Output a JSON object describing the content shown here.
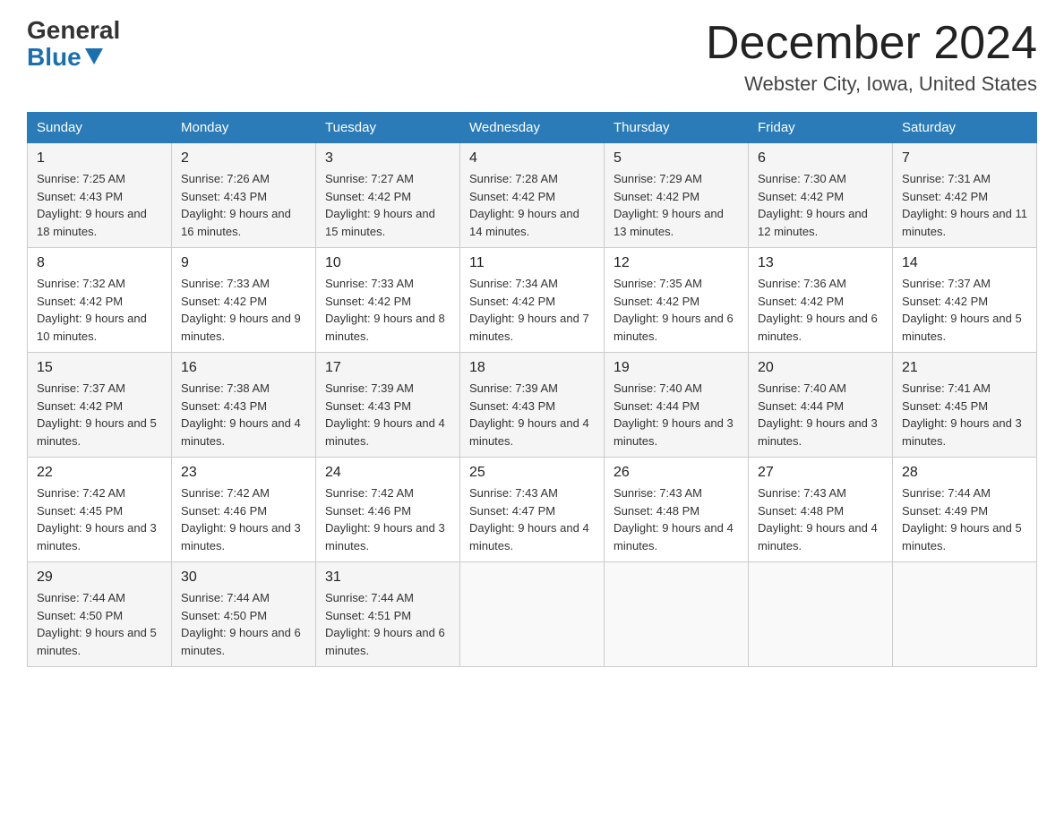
{
  "header": {
    "logo_general": "General",
    "logo_blue": "Blue",
    "month_title": "December 2024",
    "location": "Webster City, Iowa, United States"
  },
  "days_of_week": [
    "Sunday",
    "Monday",
    "Tuesday",
    "Wednesday",
    "Thursday",
    "Friday",
    "Saturday"
  ],
  "weeks": [
    [
      {
        "day": "1",
        "sunrise": "7:25 AM",
        "sunset": "4:43 PM",
        "daylight": "9 hours and 18 minutes."
      },
      {
        "day": "2",
        "sunrise": "7:26 AM",
        "sunset": "4:43 PM",
        "daylight": "9 hours and 16 minutes."
      },
      {
        "day": "3",
        "sunrise": "7:27 AM",
        "sunset": "4:42 PM",
        "daylight": "9 hours and 15 minutes."
      },
      {
        "day": "4",
        "sunrise": "7:28 AM",
        "sunset": "4:42 PM",
        "daylight": "9 hours and 14 minutes."
      },
      {
        "day": "5",
        "sunrise": "7:29 AM",
        "sunset": "4:42 PM",
        "daylight": "9 hours and 13 minutes."
      },
      {
        "day": "6",
        "sunrise": "7:30 AM",
        "sunset": "4:42 PM",
        "daylight": "9 hours and 12 minutes."
      },
      {
        "day": "7",
        "sunrise": "7:31 AM",
        "sunset": "4:42 PM",
        "daylight": "9 hours and 11 minutes."
      }
    ],
    [
      {
        "day": "8",
        "sunrise": "7:32 AM",
        "sunset": "4:42 PM",
        "daylight": "9 hours and 10 minutes."
      },
      {
        "day": "9",
        "sunrise": "7:33 AM",
        "sunset": "4:42 PM",
        "daylight": "9 hours and 9 minutes."
      },
      {
        "day": "10",
        "sunrise": "7:33 AM",
        "sunset": "4:42 PM",
        "daylight": "9 hours and 8 minutes."
      },
      {
        "day": "11",
        "sunrise": "7:34 AM",
        "sunset": "4:42 PM",
        "daylight": "9 hours and 7 minutes."
      },
      {
        "day": "12",
        "sunrise": "7:35 AM",
        "sunset": "4:42 PM",
        "daylight": "9 hours and 6 minutes."
      },
      {
        "day": "13",
        "sunrise": "7:36 AM",
        "sunset": "4:42 PM",
        "daylight": "9 hours and 6 minutes."
      },
      {
        "day": "14",
        "sunrise": "7:37 AM",
        "sunset": "4:42 PM",
        "daylight": "9 hours and 5 minutes."
      }
    ],
    [
      {
        "day": "15",
        "sunrise": "7:37 AM",
        "sunset": "4:42 PM",
        "daylight": "9 hours and 5 minutes."
      },
      {
        "day": "16",
        "sunrise": "7:38 AM",
        "sunset": "4:43 PM",
        "daylight": "9 hours and 4 minutes."
      },
      {
        "day": "17",
        "sunrise": "7:39 AM",
        "sunset": "4:43 PM",
        "daylight": "9 hours and 4 minutes."
      },
      {
        "day": "18",
        "sunrise": "7:39 AM",
        "sunset": "4:43 PM",
        "daylight": "9 hours and 4 minutes."
      },
      {
        "day": "19",
        "sunrise": "7:40 AM",
        "sunset": "4:44 PM",
        "daylight": "9 hours and 3 minutes."
      },
      {
        "day": "20",
        "sunrise": "7:40 AM",
        "sunset": "4:44 PM",
        "daylight": "9 hours and 3 minutes."
      },
      {
        "day": "21",
        "sunrise": "7:41 AM",
        "sunset": "4:45 PM",
        "daylight": "9 hours and 3 minutes."
      }
    ],
    [
      {
        "day": "22",
        "sunrise": "7:42 AM",
        "sunset": "4:45 PM",
        "daylight": "9 hours and 3 minutes."
      },
      {
        "day": "23",
        "sunrise": "7:42 AM",
        "sunset": "4:46 PM",
        "daylight": "9 hours and 3 minutes."
      },
      {
        "day": "24",
        "sunrise": "7:42 AM",
        "sunset": "4:46 PM",
        "daylight": "9 hours and 3 minutes."
      },
      {
        "day": "25",
        "sunrise": "7:43 AM",
        "sunset": "4:47 PM",
        "daylight": "9 hours and 4 minutes."
      },
      {
        "day": "26",
        "sunrise": "7:43 AM",
        "sunset": "4:48 PM",
        "daylight": "9 hours and 4 minutes."
      },
      {
        "day": "27",
        "sunrise": "7:43 AM",
        "sunset": "4:48 PM",
        "daylight": "9 hours and 4 minutes."
      },
      {
        "day": "28",
        "sunrise": "7:44 AM",
        "sunset": "4:49 PM",
        "daylight": "9 hours and 5 minutes."
      }
    ],
    [
      {
        "day": "29",
        "sunrise": "7:44 AM",
        "sunset": "4:50 PM",
        "daylight": "9 hours and 5 minutes."
      },
      {
        "day": "30",
        "sunrise": "7:44 AM",
        "sunset": "4:50 PM",
        "daylight": "9 hours and 6 minutes."
      },
      {
        "day": "31",
        "sunrise": "7:44 AM",
        "sunset": "4:51 PM",
        "daylight": "9 hours and 6 minutes."
      },
      null,
      null,
      null,
      null
    ]
  ]
}
